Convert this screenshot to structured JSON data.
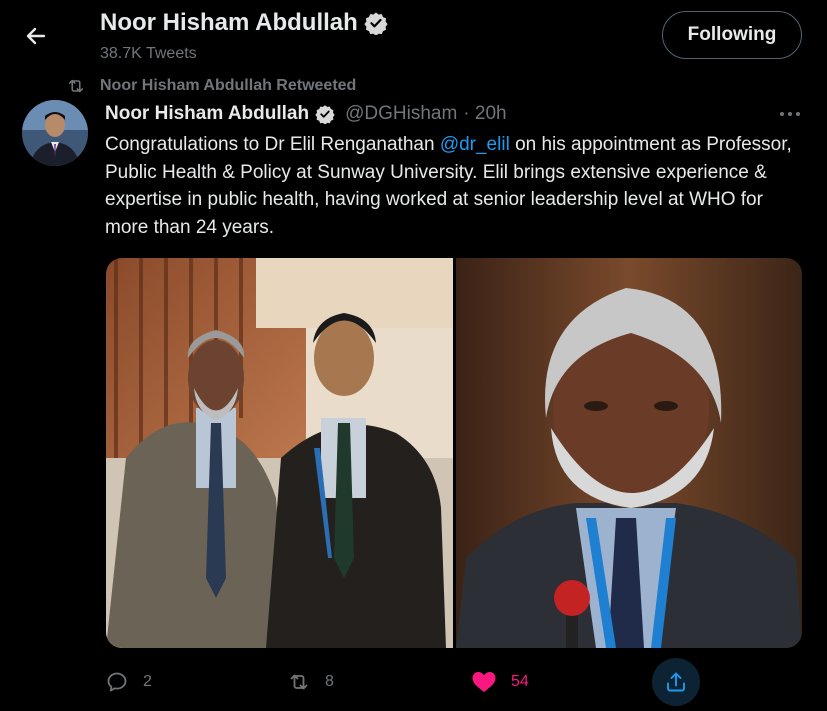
{
  "header": {
    "name": "Noor Hisham Abdullah",
    "tweet_count": "38.7K Tweets",
    "follow_label": "Following"
  },
  "tweet": {
    "retweet_text": "Noor Hisham Abdullah Retweeted",
    "author_name": "Noor Hisham Abdullah",
    "author_handle": "@DGHisham",
    "time": "· 20h",
    "text_part1": "Congratulations to Dr Elil Renganathan ",
    "mention": "@dr_elil",
    "text_part2": " on his appointment as Professor, Public Health & Policy at Sunway University. Elil brings extensive experience & expertise in public health, having worked at senior leadership level at WHO for more than 24 years.",
    "replies": "2",
    "retweets": "8",
    "likes": "54"
  },
  "colors": {
    "accent": "#1d9bf0",
    "like": "#f91880",
    "muted": "#71767b",
    "background": "#000000"
  },
  "icons": [
    "back-arrow-icon",
    "verified-badge-icon",
    "retweet-icon",
    "more-icon",
    "reply-icon",
    "heart-icon",
    "share-icon"
  ]
}
